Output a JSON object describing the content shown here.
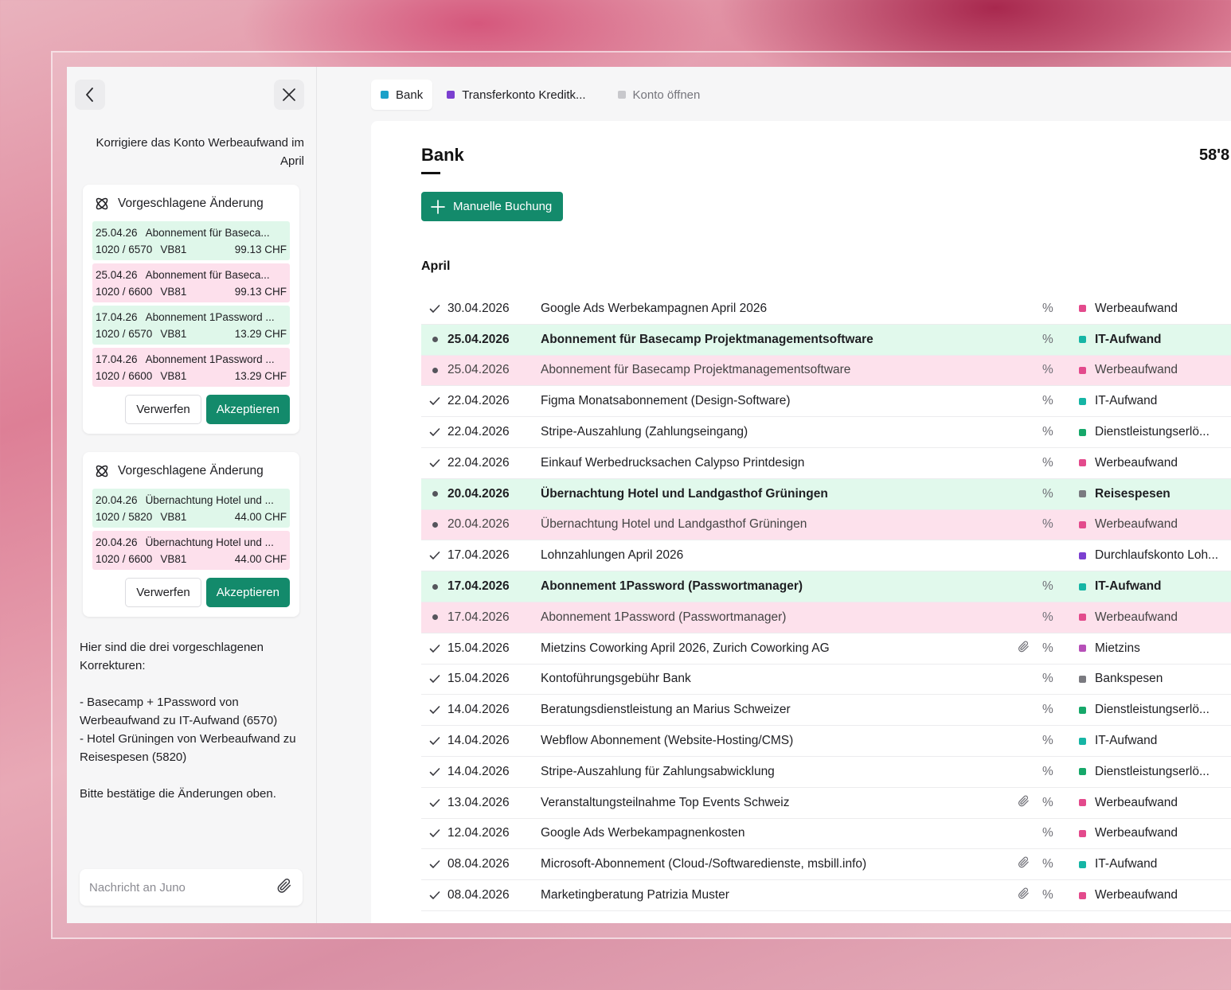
{
  "chat": {
    "user_message": "Korrigiere das Konto Werbeaufwand im April",
    "cards": [
      {
        "title": "Vorgeschlagene Änderung",
        "changes": [
          {
            "type": "add",
            "date": "25.04.26",
            "text": "Abonnement für Baseca...",
            "accounts": "1020 / 6570",
            "vat": "VB81",
            "amount": "99.13 CHF"
          },
          {
            "type": "del",
            "date": "25.04.26",
            "text": "Abonnement für Baseca...",
            "accounts": "1020 / 6600",
            "vat": "VB81",
            "amount": "99.13 CHF"
          },
          {
            "type": "add",
            "date": "17.04.26",
            "text": "Abonnement 1Password ...",
            "accounts": "1020 / 6570",
            "vat": "VB81",
            "amount": "13.29 CHF"
          },
          {
            "type": "del",
            "date": "17.04.26",
            "text": "Abonnement 1Password ...",
            "accounts": "1020 / 6600",
            "vat": "VB81",
            "amount": "13.29 CHF"
          }
        ],
        "reject_label": "Verwerfen",
        "accept_label": "Akzeptieren"
      },
      {
        "title": "Vorgeschlagene Änderung",
        "changes": [
          {
            "type": "add",
            "date": "20.04.26",
            "text": "Übernachtung Hotel und ...",
            "accounts": "1020 / 5820",
            "vat": "VB81",
            "amount": "44.00 CHF"
          },
          {
            "type": "del",
            "date": "20.04.26",
            "text": "Übernachtung Hotel und ...",
            "accounts": "1020 / 6600",
            "vat": "VB81",
            "amount": "44.00 CHF"
          }
        ],
        "reject_label": "Verwerfen",
        "accept_label": "Akzeptieren"
      }
    ],
    "ai_message": "Hier sind die drei vorgeschlagenen Korrekturen:\n\n- Basecamp + 1Password von Werbeaufwand zu IT-Aufwand (6570)\n- Hotel Grüningen von Werbeaufwand zu Reisespesen (5820)\n\nBitte bestätige die Änderungen oben.",
    "input_placeholder": "Nachricht an Juno"
  },
  "tabs": [
    {
      "label": "Bank",
      "color": "#1aa1c9",
      "active": true
    },
    {
      "label": "Transferkonto Kreditk...",
      "color": "#7b3fd0",
      "active": false
    },
    {
      "label": "Konto öffnen",
      "color": "#c8c8cc",
      "active": false,
      "muted": true
    }
  ],
  "main": {
    "title": "Bank",
    "balance": "58'8",
    "manual_button": "Manuelle Buchung",
    "month": "April",
    "rows": [
      {
        "state": "ok",
        "date": "30.04.2026",
        "desc": "Google Ads Werbekampagnen April 2026",
        "clip": false,
        "pct": "%",
        "account": "Werbeaufwand",
        "color": "#e34a8c"
      },
      {
        "state": "add",
        "date": "25.04.2026",
        "desc": "Abonnement für Basecamp Projektmanagementsoftware",
        "clip": false,
        "pct": "%",
        "account": "IT-Aufwand",
        "color": "#16b5a5"
      },
      {
        "state": "del",
        "date": "25.04.2026",
        "desc": "Abonnement für Basecamp Projektmanagementsoftware",
        "clip": false,
        "pct": "%",
        "account": "Werbeaufwand",
        "color": "#e34a8c"
      },
      {
        "state": "ok",
        "date": "22.04.2026",
        "desc": "Figma Monatsabonnement (Design-Software)",
        "clip": false,
        "pct": "%",
        "account": "IT-Aufwand",
        "color": "#16b5a5"
      },
      {
        "state": "ok",
        "date": "22.04.2026",
        "desc": "Stripe-Auszahlung (Zahlungseingang)",
        "clip": false,
        "pct": "%",
        "account": "Dienstleistungserlö...",
        "color": "#16a86a"
      },
      {
        "state": "ok",
        "date": "22.04.2026",
        "desc": "Einkauf Werbedrucksachen Calypso Printdesign",
        "clip": false,
        "pct": "%",
        "account": "Werbeaufwand",
        "color": "#e34a8c"
      },
      {
        "state": "add",
        "date": "20.04.2026",
        "desc": "Übernachtung Hotel und Landgasthof Grüningen",
        "clip": false,
        "pct": "%",
        "account": "Reisespesen",
        "color": "#7a7a80"
      },
      {
        "state": "del",
        "date": "20.04.2026",
        "desc": "Übernachtung Hotel und Landgasthof Grüningen",
        "clip": false,
        "pct": "%",
        "account": "Werbeaufwand",
        "color": "#e34a8c"
      },
      {
        "state": "ok",
        "date": "17.04.2026",
        "desc": "Lohnzahlungen April 2026",
        "clip": false,
        "pct": "",
        "account": "Durchlaufskonto Loh...",
        "color": "#7b3fd0"
      },
      {
        "state": "add",
        "date": "17.04.2026",
        "desc": "Abonnement 1Password (Passwortmanager)",
        "clip": false,
        "pct": "%",
        "account": "IT-Aufwand",
        "color": "#16b5a5"
      },
      {
        "state": "del",
        "date": "17.04.2026",
        "desc": "Abonnement 1Password (Passwortmanager)",
        "clip": false,
        "pct": "%",
        "account": "Werbeaufwand",
        "color": "#e34a8c"
      },
      {
        "state": "ok",
        "date": "15.04.2026",
        "desc": "Mietzins Coworking April 2026, Zurich Coworking AG",
        "clip": true,
        "pct": "%",
        "account": "Mietzins",
        "color": "#b64fb8"
      },
      {
        "state": "ok",
        "date": "15.04.2026",
        "desc": "Kontoführungsgebühr Bank",
        "clip": false,
        "pct": "%",
        "account": "Bankspesen",
        "color": "#7a7a80"
      },
      {
        "state": "ok",
        "date": "14.04.2026",
        "desc": "Beratungsdienstleistung an Marius Schweizer",
        "clip": false,
        "pct": "%",
        "account": "Dienstleistungserlö...",
        "color": "#16a86a"
      },
      {
        "state": "ok",
        "date": "14.04.2026",
        "desc": "Webflow Abonnement (Website-Hosting/CMS)",
        "clip": false,
        "pct": "%",
        "account": "IT-Aufwand",
        "color": "#16b5a5"
      },
      {
        "state": "ok",
        "date": "14.04.2026",
        "desc": "Stripe-Auszahlung für Zahlungsabwicklung",
        "clip": false,
        "pct": "%",
        "account": "Dienstleistungserlö...",
        "color": "#16a86a"
      },
      {
        "state": "ok",
        "date": "13.04.2026",
        "desc": "Veranstaltungsteilnahme Top Events Schweiz",
        "clip": true,
        "pct": "%",
        "account": "Werbeaufwand",
        "color": "#e34a8c"
      },
      {
        "state": "ok",
        "date": "12.04.2026",
        "desc": "Google Ads Werbekampagnenkosten",
        "clip": false,
        "pct": "%",
        "account": "Werbeaufwand",
        "color": "#e34a8c"
      },
      {
        "state": "ok",
        "date": "08.04.2026",
        "desc": "Microsoft-Abonnement (Cloud-/Softwaredienste, msbill.info)",
        "clip": true,
        "pct": "%",
        "account": "IT-Aufwand",
        "color": "#16b5a5"
      },
      {
        "state": "ok",
        "date": "08.04.2026",
        "desc": "Marketingberatung Patrizia Muster",
        "clip": true,
        "pct": "%",
        "account": "Werbeaufwand",
        "color": "#e34a8c"
      }
    ]
  }
}
